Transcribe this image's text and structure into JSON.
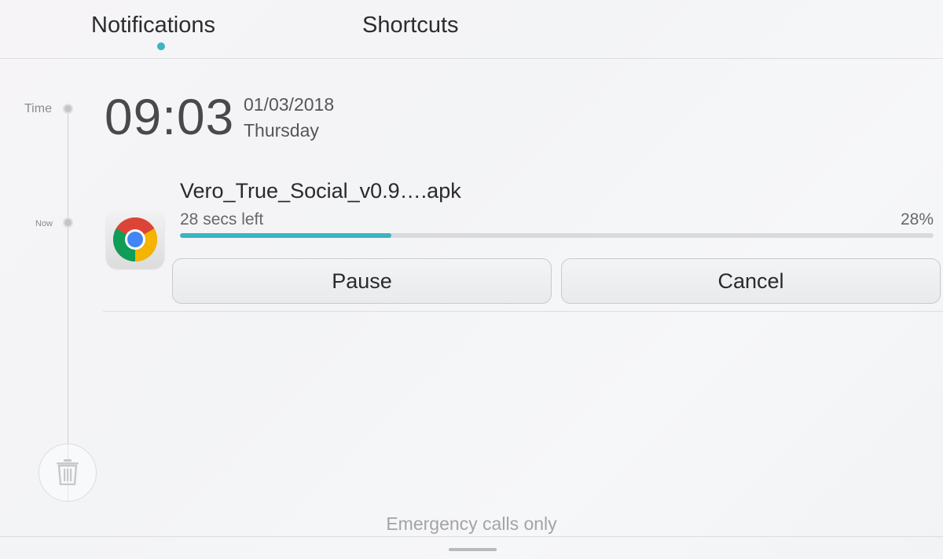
{
  "tabs": {
    "notifications": "Notifications",
    "shortcuts": "Shortcuts",
    "active_tab": "notifications",
    "accent_color": "#3fb3c2"
  },
  "timeline": {
    "time_label": "Time",
    "now_label": "Now",
    "clear_icon": "trash-icon"
  },
  "clock": {
    "time": "09:03",
    "date": "01/03/2018",
    "day": "Thursday"
  },
  "notification": {
    "app_icon": "chrome-icon",
    "file_name": "Vero_True_Social_v0.9….apk",
    "time_left": "28 secs left",
    "progress_label": "28%",
    "progress_value": 0.28,
    "progress_color": "#3ab5c0",
    "pause_label": "Pause",
    "cancel_label": "Cancel"
  },
  "footer": {
    "status_text": "Emergency calls only"
  }
}
